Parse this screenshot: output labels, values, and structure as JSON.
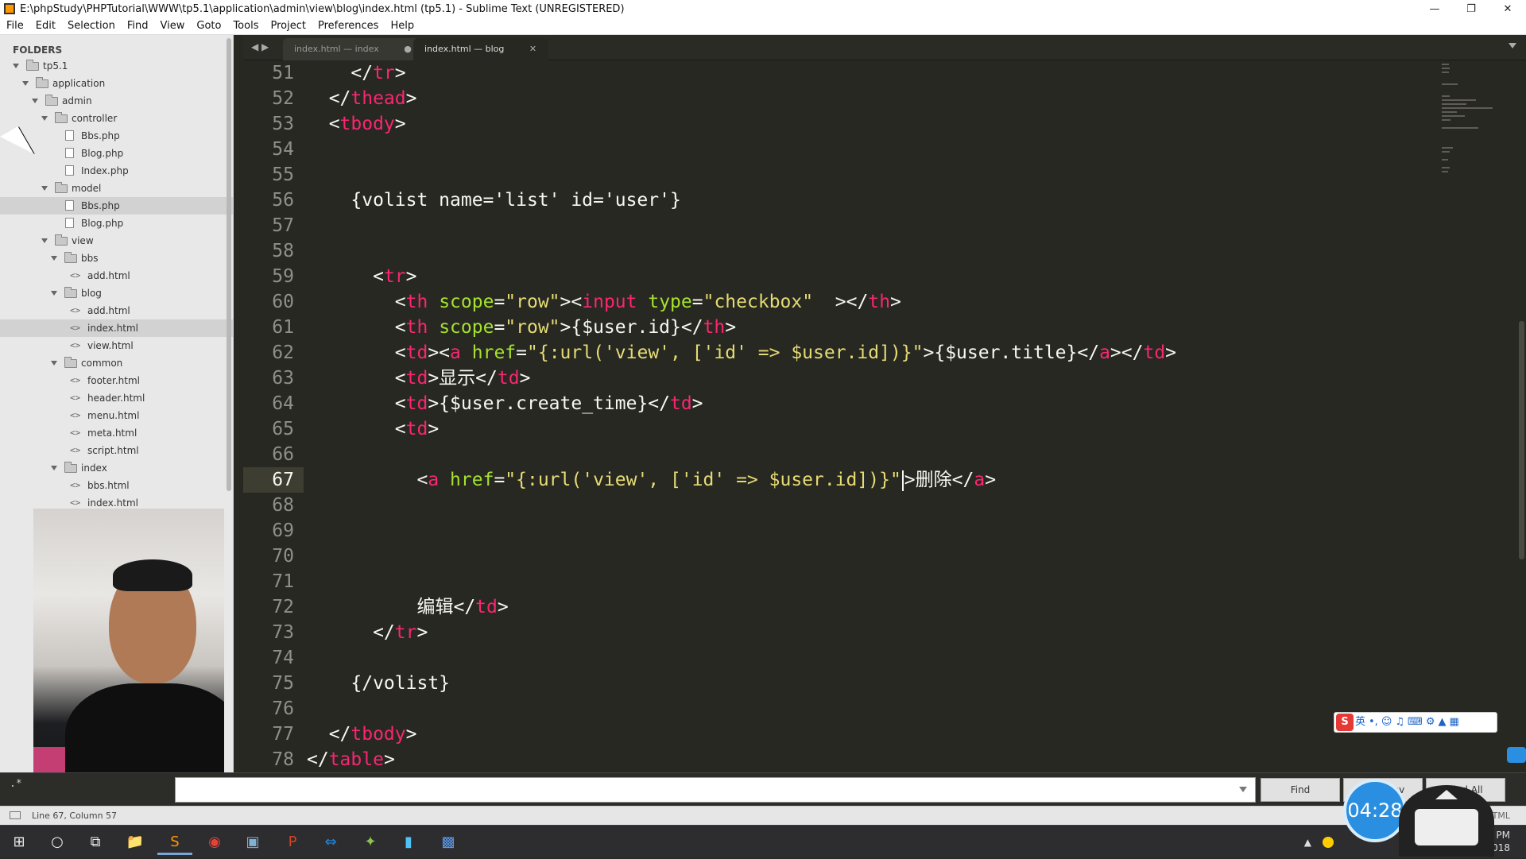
{
  "window": {
    "title": "E:\\phpStudy\\PHPTutorial\\WWW\\tp5.1\\application\\admin\\view\\blog\\index.html (tp5.1) - Sublime Text (UNREGISTERED)"
  },
  "menu": [
    "File",
    "Edit",
    "Selection",
    "Find",
    "View",
    "Goto",
    "Tools",
    "Project",
    "Preferences",
    "Help"
  ],
  "sidebar": {
    "header": "FOLDERS",
    "tree": [
      {
        "label": "tp5.1",
        "type": "folder",
        "depth": 0,
        "open": true
      },
      {
        "label": "application",
        "type": "folder",
        "depth": 1,
        "open": true
      },
      {
        "label": "admin",
        "type": "folder",
        "depth": 2,
        "open": true
      },
      {
        "label": "controller",
        "type": "folder",
        "depth": 3,
        "open": true
      },
      {
        "label": "Bbs.php",
        "type": "file",
        "depth": 4
      },
      {
        "label": "Blog.php",
        "type": "file",
        "depth": 4
      },
      {
        "label": "Index.php",
        "type": "file",
        "depth": 4
      },
      {
        "label": "model",
        "type": "folder",
        "depth": 3,
        "open": true
      },
      {
        "label": "Bbs.php",
        "type": "file",
        "depth": 4,
        "selected": true
      },
      {
        "label": "Blog.php",
        "type": "file",
        "depth": 4
      },
      {
        "label": "view",
        "type": "folder",
        "depth": 3,
        "open": true
      },
      {
        "label": "bbs",
        "type": "folder",
        "depth": 4,
        "open": true
      },
      {
        "label": "add.html",
        "type": "html",
        "depth": 5
      },
      {
        "label": "blog",
        "type": "folder",
        "depth": 4,
        "open": true
      },
      {
        "label": "add.html",
        "type": "html",
        "depth": 5
      },
      {
        "label": "index.html",
        "type": "html",
        "depth": 5,
        "selected": true
      },
      {
        "label": "view.html",
        "type": "html",
        "depth": 5
      },
      {
        "label": "common",
        "type": "folder",
        "depth": 4,
        "open": true
      },
      {
        "label": "footer.html",
        "type": "html",
        "depth": 5
      },
      {
        "label": "header.html",
        "type": "html",
        "depth": 5
      },
      {
        "label": "menu.html",
        "type": "html",
        "depth": 5
      },
      {
        "label": "meta.html",
        "type": "html",
        "depth": 5
      },
      {
        "label": "script.html",
        "type": "html",
        "depth": 5
      },
      {
        "label": "index",
        "type": "folder",
        "depth": 4,
        "open": true
      },
      {
        "label": "bbs.html",
        "type": "html",
        "depth": 5
      },
      {
        "label": "index.html",
        "type": "html",
        "depth": 5
      }
    ]
  },
  "tabs": [
    {
      "label": "index.html — index",
      "active": false,
      "close": "●"
    },
    {
      "label": "index.html — blog",
      "active": true,
      "close": "✕"
    }
  ],
  "editor": {
    "current_line": 67,
    "lines": [
      {
        "n": 51,
        "html": "    &lt;/<span class=\"t\">tr</span>&gt;"
      },
      {
        "n": 52,
        "html": "  &lt;/<span class=\"t\">thead</span>&gt;"
      },
      {
        "n": 53,
        "html": "  &lt;<span class=\"t\">tbody</span>&gt;"
      },
      {
        "n": 54,
        "html": ""
      },
      {
        "n": 55,
        "html": ""
      },
      {
        "n": 56,
        "html": "    {volist name='list' id='user'}"
      },
      {
        "n": 57,
        "html": ""
      },
      {
        "n": 58,
        "html": ""
      },
      {
        "n": 59,
        "html": "      &lt;<span class=\"t\">tr</span>&gt;"
      },
      {
        "n": 60,
        "html": "        &lt;<span class=\"t\">th</span> <span class=\"a\">scope</span>=<span class=\"s\">\"row\"</span>&gt;&lt;<span class=\"t\">input</span> <span class=\"a\">type</span>=<span class=\"s\">\"checkbox\"</span>  &gt;&lt;/<span class=\"t\">th</span>&gt;"
      },
      {
        "n": 61,
        "html": "        &lt;<span class=\"t\">th</span> <span class=\"a\">scope</span>=<span class=\"s\">\"row\"</span>&gt;{$user.id}&lt;/<span class=\"t\">th</span>&gt;"
      },
      {
        "n": 62,
        "html": "        &lt;<span class=\"t\">td</span>&gt;&lt;<span class=\"t\">a</span> <span class=\"a\">href</span>=<span class=\"s\">\"{:url('view', ['id' =&gt; $user.id])}\"</span>&gt;{$user.title}&lt;/<span class=\"t\">a</span>&gt;&lt;/<span class=\"t\">td</span>&gt;"
      },
      {
        "n": 63,
        "html": "        &lt;<span class=\"t\">td</span>&gt;显示&lt;/<span class=\"t\">td</span>&gt;"
      },
      {
        "n": 64,
        "html": "        &lt;<span class=\"t\">td</span>&gt;{$user.create_time}&lt;/<span class=\"t\">td</span>&gt;"
      },
      {
        "n": 65,
        "html": "        &lt;<span class=\"t\">td</span>&gt;"
      },
      {
        "n": 66,
        "html": ""
      },
      {
        "n": 67,
        "html": "          &lt;<span class=\"t\">a</span> <span class=\"a\">href</span>=<span class=\"s\">\"{:url('view', ['id' =&gt; $user.id])}\"</span><span class=\"cursor\"></span>&gt;删除&lt;/<span class=\"t\">a</span>&gt;"
      },
      {
        "n": 68,
        "html": ""
      },
      {
        "n": 69,
        "html": ""
      },
      {
        "n": 70,
        "html": ""
      },
      {
        "n": 71,
        "html": ""
      },
      {
        "n": 72,
        "html": "          编辑&lt;/<span class=\"t\">td</span>&gt;"
      },
      {
        "n": 73,
        "html": "      &lt;/<span class=\"t\">tr</span>&gt;"
      },
      {
        "n": 74,
        "html": ""
      },
      {
        "n": 75,
        "html": "    {/volist}"
      },
      {
        "n": 76,
        "html": ""
      },
      {
        "n": 77,
        "html": "  &lt;/<span class=\"t\">tbody</span>&gt;"
      },
      {
        "n": 78,
        "html": "&lt;/<span class=\"t\">table</span>&gt;"
      }
    ]
  },
  "findbar": {
    "regex_label": ".*",
    "find_label": "Find",
    "find_prev_label": "Find Prev",
    "find_all_label": "Find All"
  },
  "status": {
    "position": "Line 67, Column 57",
    "syntax": "HTML"
  },
  "overlay": {
    "timer": "04:28",
    "ime_label": "英"
  },
  "taskbar": {
    "clock_time": "5:02 PM",
    "clock_date": "7/26/2018"
  },
  "colors": {
    "bg": "#272822",
    "tag": "#f92672",
    "string": "#e6db74",
    "attr": "#a6e22e",
    "text": "#f8f8f2"
  }
}
